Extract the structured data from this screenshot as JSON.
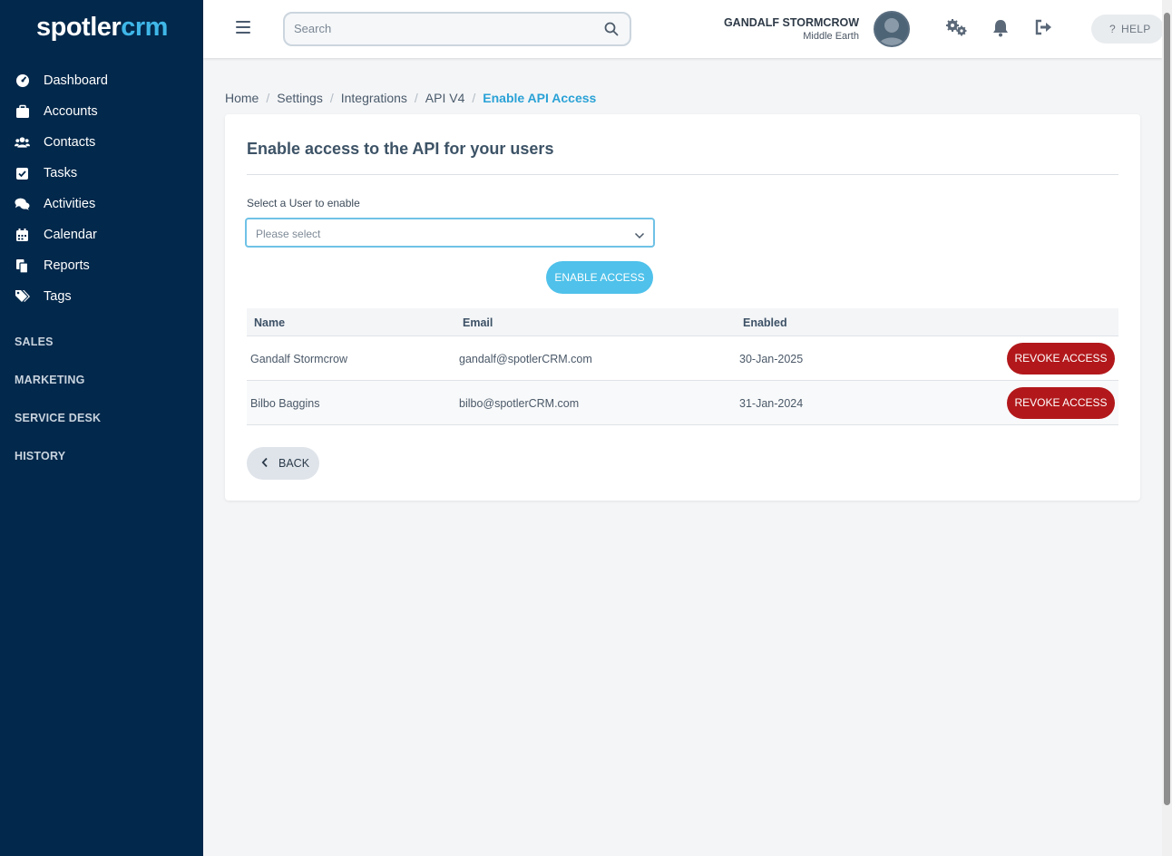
{
  "brand": {
    "logo_part1": "spotler",
    "logo_part2": "crm",
    "accent": "#3fb7e8",
    "sidebar_bg": "#02284b"
  },
  "sidebar": {
    "items": [
      {
        "label": "Dashboard",
        "icon": "dashboard-icon"
      },
      {
        "label": "Accounts",
        "icon": "briefcase-icon"
      },
      {
        "label": "Contacts",
        "icon": "users-icon"
      },
      {
        "label": "Tasks",
        "icon": "checkbox-icon"
      },
      {
        "label": "Activities",
        "icon": "comments-icon"
      },
      {
        "label": "Calendar",
        "icon": "calendar-icon"
      },
      {
        "label": "Reports",
        "icon": "copy-icon"
      },
      {
        "label": "Tags",
        "icon": "tags-icon"
      }
    ],
    "sections": [
      "SALES",
      "MARKETING",
      "SERVICE DESK",
      "HISTORY"
    ]
  },
  "topbar": {
    "search_placeholder": "Search",
    "user_name": "GANDALF STORMCROW",
    "user_location": "Middle Earth",
    "help_label": "HELP"
  },
  "breadcrumb": {
    "items": [
      "Home",
      "Settings",
      "Integrations",
      "API V4"
    ],
    "current": "Enable API Access"
  },
  "card": {
    "title": "Enable access to the API for your users",
    "field_label": "Select a User to enable",
    "select_placeholder": "Please select",
    "enable_button": "ENABLE ACCESS",
    "back_button": "BACK"
  },
  "table": {
    "columns": [
      "Name",
      "Email",
      "Enabled"
    ],
    "rows": [
      {
        "name": "Gandalf Stormcrow",
        "email": "gandalf@spotlerCRM.com",
        "enabled": "30-Jan-2025",
        "action": "REVOKE ACCESS"
      },
      {
        "name": "Bilbo Baggins",
        "email": "bilbo@spotlerCRM.com",
        "enabled": "31-Jan-2024",
        "action": "REVOKE ACCESS"
      }
    ]
  }
}
